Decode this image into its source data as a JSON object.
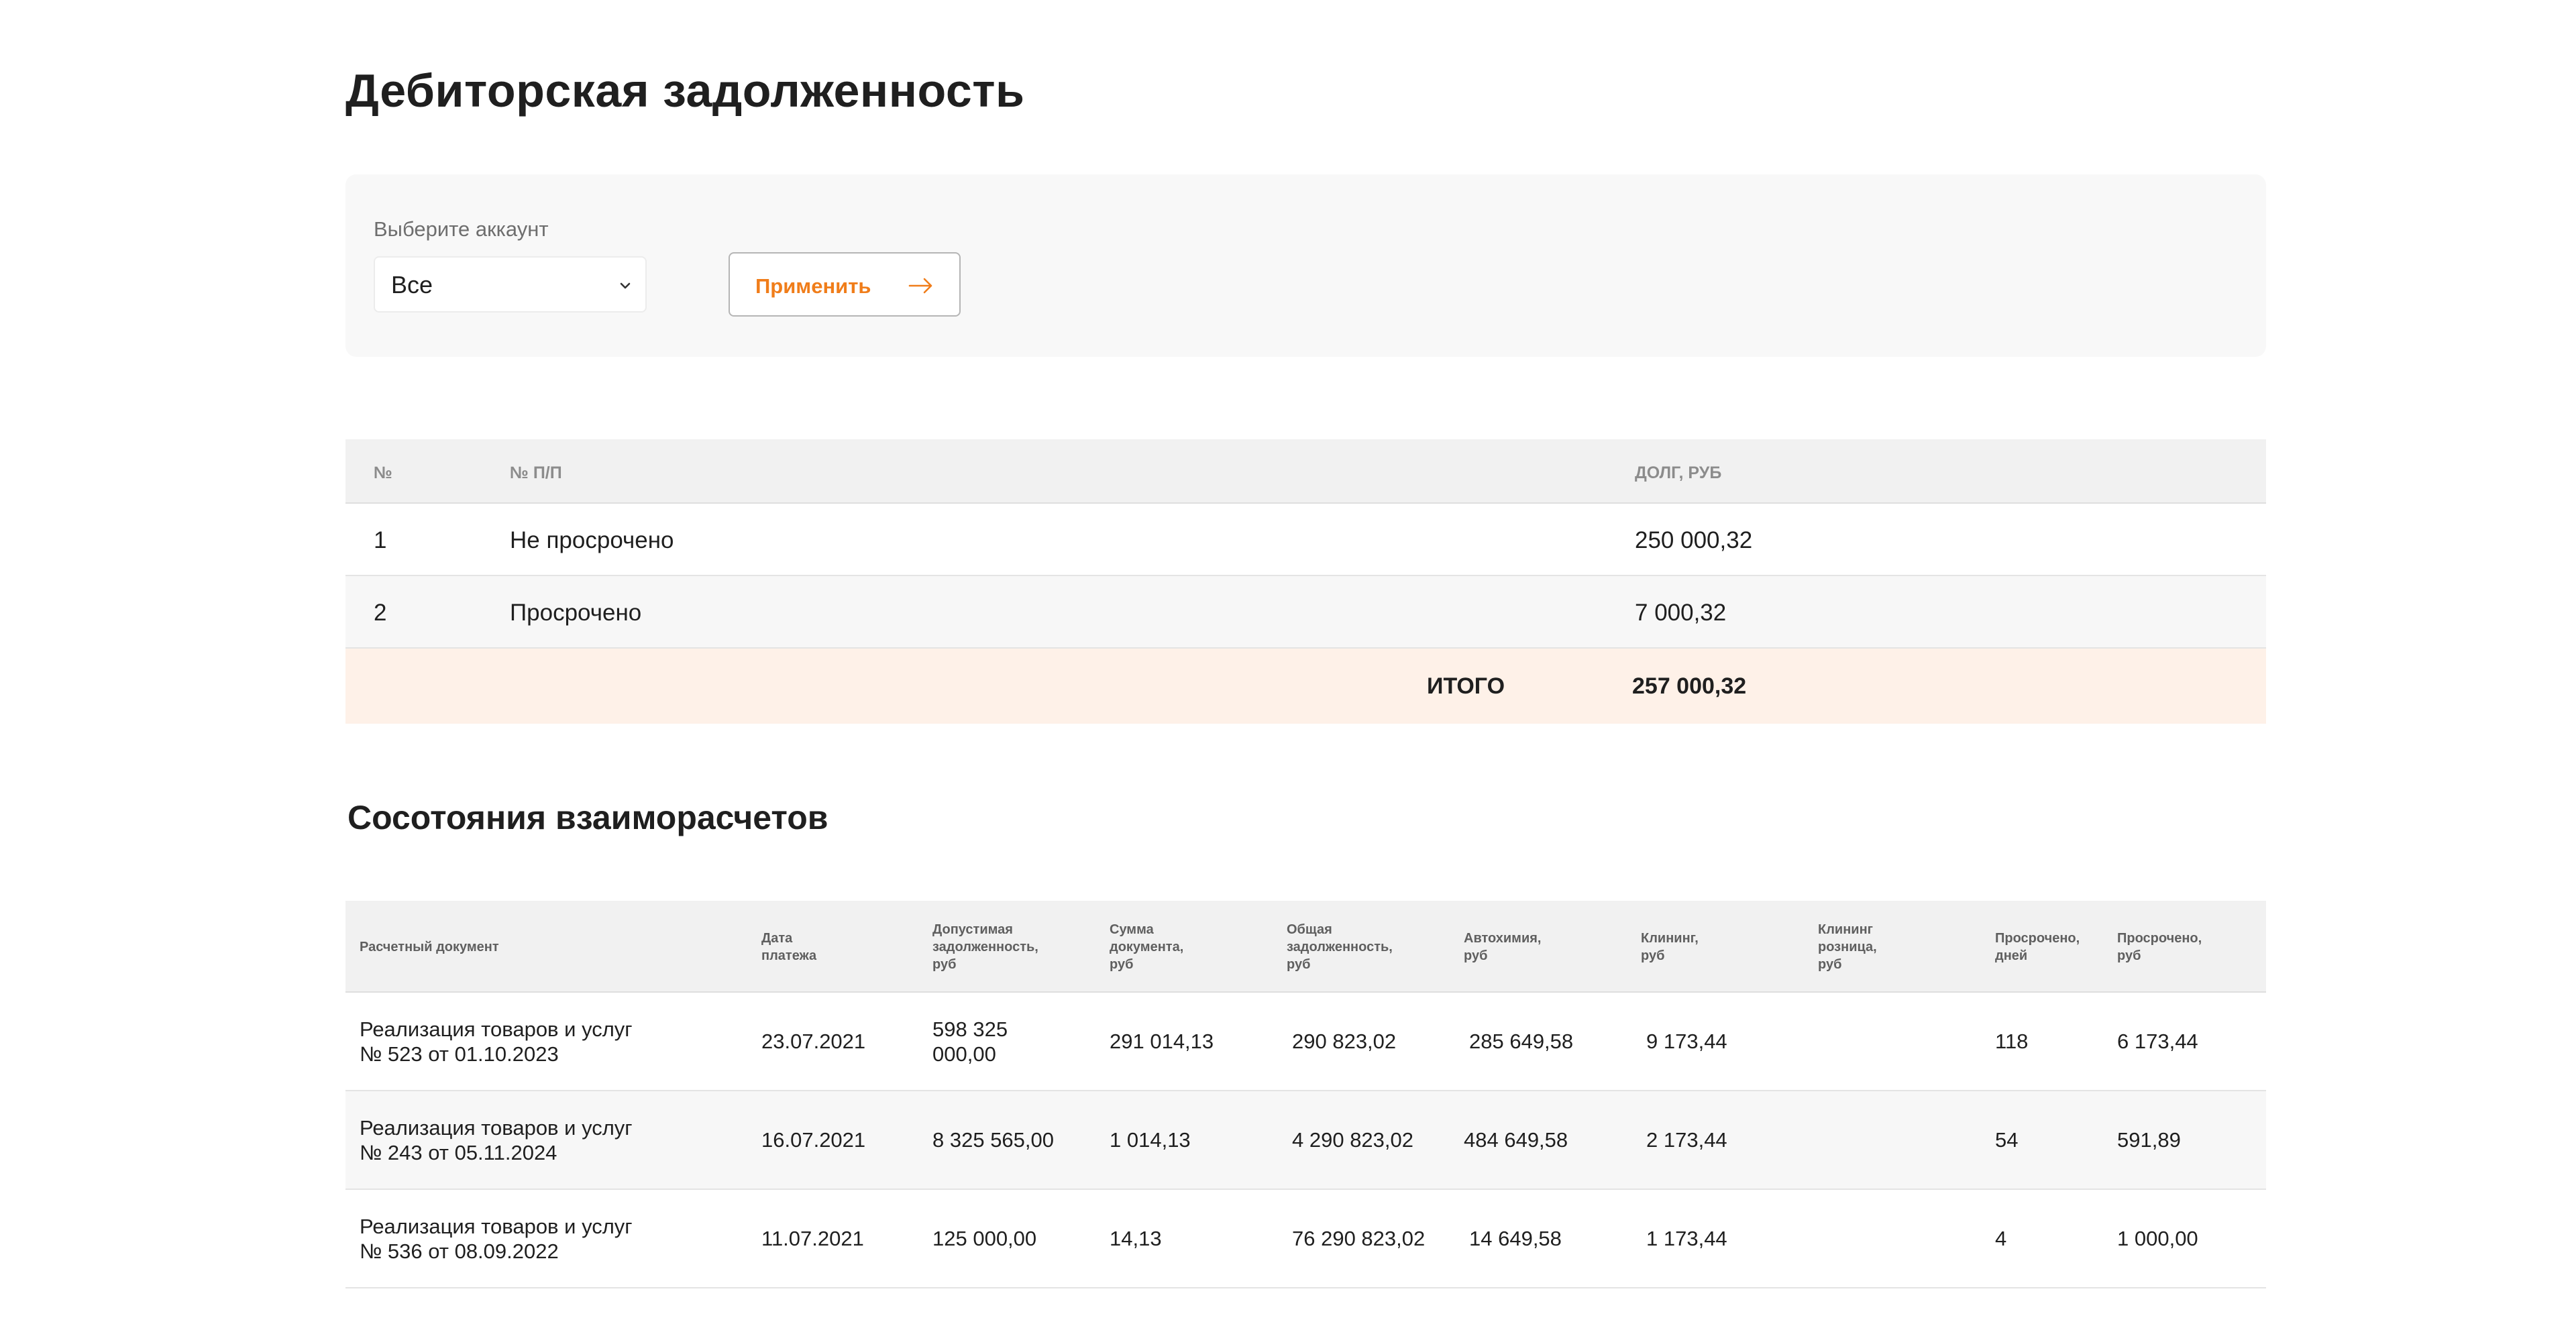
{
  "page": {
    "title": "Дебиторская задолженность"
  },
  "filter": {
    "label": "Выберите аккаунт",
    "selected": "Все",
    "apply_label": "Применить",
    "accent_color": "#f07d1a"
  },
  "summary": {
    "headers": [
      "№",
      "№ П/П",
      "ДОЛГ, РУБ"
    ],
    "rows": [
      {
        "num": "1",
        "name": "Не просрочено",
        "debt": "250 000,32"
      },
      {
        "num": "2",
        "name": "Просрочено",
        "debt": "7 000,32"
      }
    ],
    "total_label": "ИТОГО",
    "total_value": "257 000,32",
    "total_bg": "#fef1e8"
  },
  "settlements": {
    "title": "Сосотояния взаиморасчетов",
    "headers": [
      [
        "Расчетный документ"
      ],
      [
        "Дата",
        "платежа"
      ],
      [
        "Допустимая",
        "задолженность,",
        "руб"
      ],
      [
        "Сумма",
        "документа,",
        "руб"
      ],
      [
        "Общая",
        "задолженность,",
        "руб"
      ],
      [
        "Автохимия,",
        "руб"
      ],
      [
        "Клининг,",
        "руб"
      ],
      [
        "Клининг",
        "розница,",
        "руб"
      ],
      [
        "Просрочено,",
        "дней"
      ],
      [
        "Просрочено,",
        "руб"
      ]
    ],
    "rows": [
      {
        "doc": [
          "Реализация товаров и услуг",
          "№ 523 от 01.10.2023"
        ],
        "date": "23.07.2021",
        "allowed": [
          "598 325",
          "000,00"
        ],
        "doc_sum": "291 014,13",
        "total_debt": "290 823,02",
        "autochem": "285 649,58",
        "cleaning": "9 173,44",
        "cleaning_retail": "",
        "overdue_days": "118",
        "overdue_rub": "6 173,44"
      },
      {
        "doc": [
          "Реализация товаров и услуг",
          "№ 243 от 05.11.2024"
        ],
        "date": "16.07.2021",
        "allowed": [
          "8 325 565,00"
        ],
        "doc_sum": "1 014,13",
        "total_debt": "4 290 823,02",
        "autochem": "484 649,58",
        "cleaning": "2 173,44",
        "cleaning_retail": "",
        "overdue_days": "54",
        "overdue_rub": "591,89"
      },
      {
        "doc": [
          "Реализация товаров и услуг",
          "№ 536 от 08.09.2022"
        ],
        "date": "11.07.2021",
        "allowed": [
          "125 000,00"
        ],
        "doc_sum": "14,13",
        "total_debt": "76 290 823,02",
        "autochem": "14 649,58",
        "cleaning": "1 173,44",
        "cleaning_retail": "",
        "overdue_days": "4",
        "overdue_rub": "1 000,00"
      }
    ]
  }
}
